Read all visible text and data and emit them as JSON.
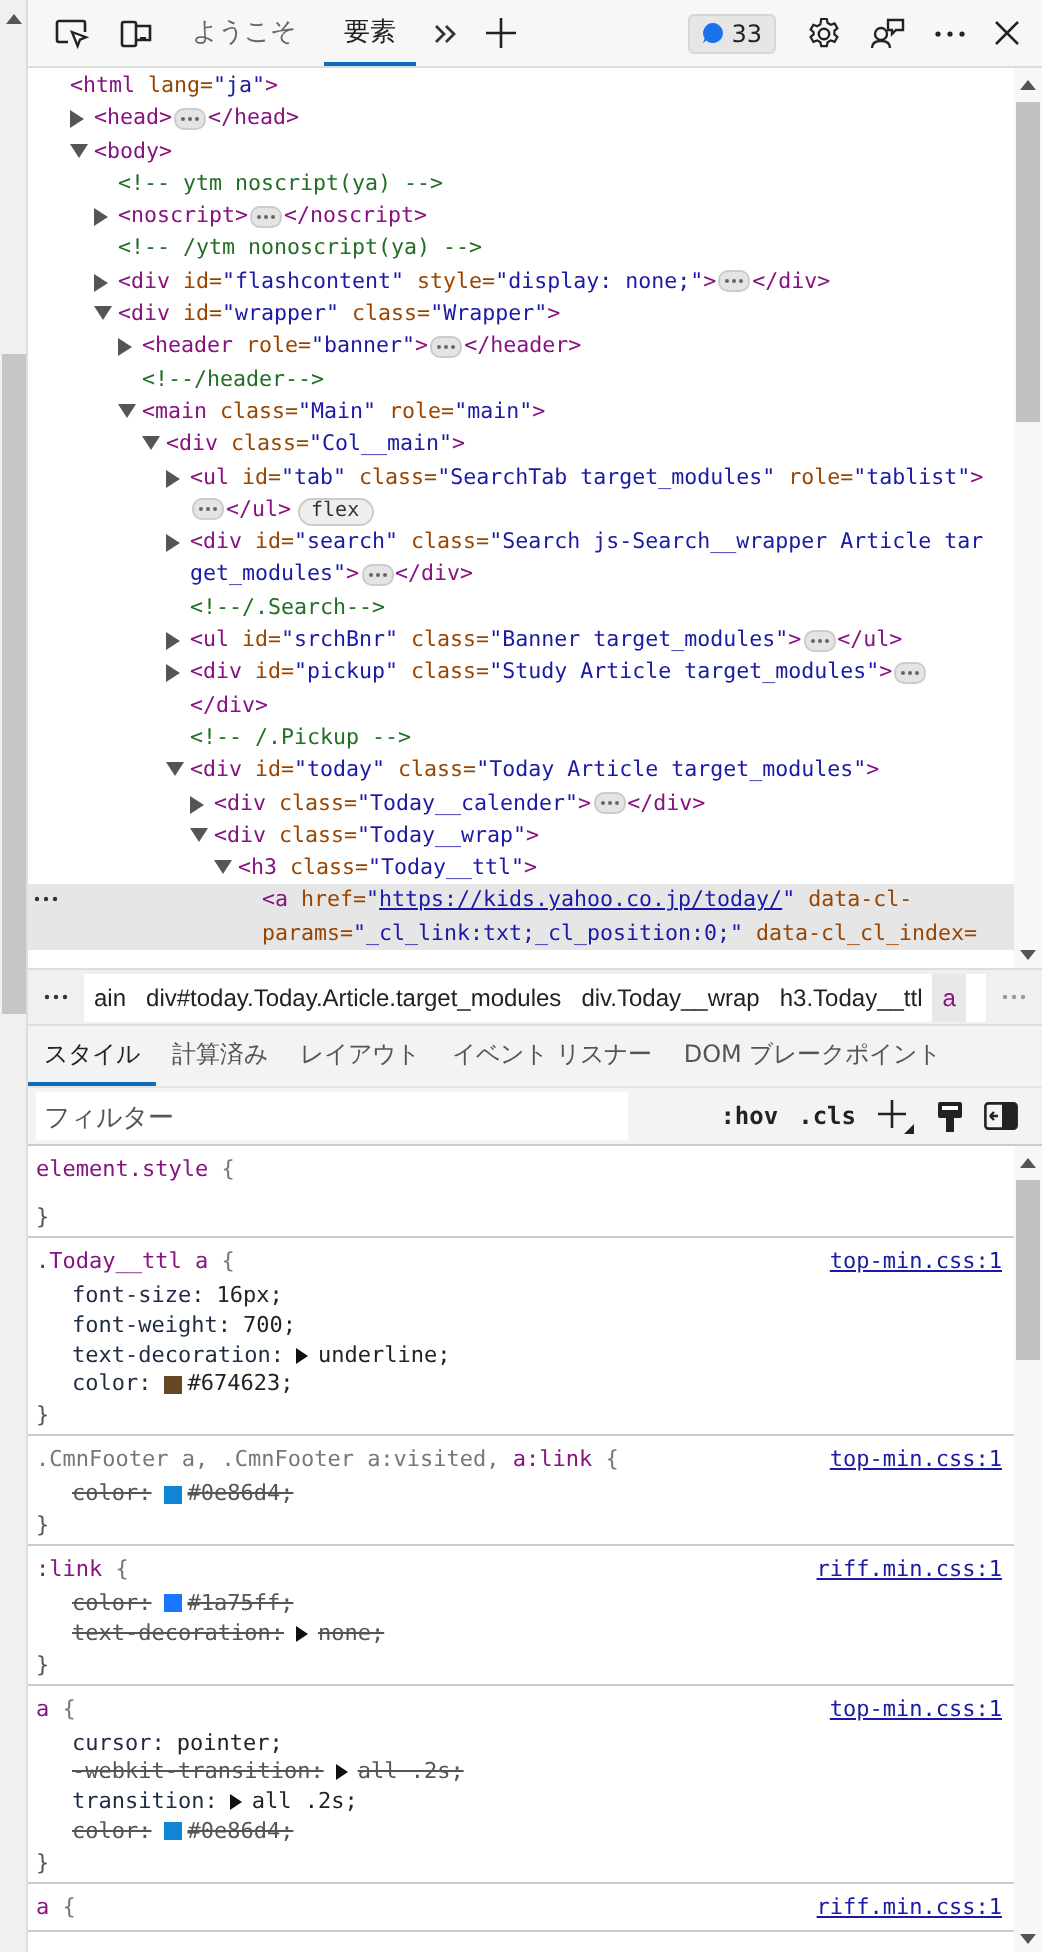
{
  "toolbar": {
    "tabs": [
      {
        "label": "ようこそ",
        "selected": false
      },
      {
        "label": "要素",
        "selected": true
      }
    ],
    "issues_count": "33"
  },
  "dom": [
    {
      "selected": false,
      "lines": [
        [
          {
            "kind": "code",
            "parts": [
              {
                "kind": "tag",
                "text": "<html"
              },
              {
                "kind": "attr",
                "text": " lang="
              },
              {
                "kind": "val",
                "text": "\"ja\""
              },
              {
                "kind": "tag",
                "text": ">"
              }
            ]
          }
        ]
      ],
      "children": [
        {
          "selected": false,
          "expanded": false,
          "lines": [
            [
              {
                "kind": "code",
                "parts": [
                  {
                    "kind": "tag",
                    "text": "<head>"
                  }
                ]
              },
              {
                "kind": "ellipsis"
              },
              {
                "kind": "code",
                "parts": [
                  {
                    "kind": "tag",
                    "text": "</head>"
                  }
                ]
              }
            ]
          ]
        },
        {
          "selected": false,
          "expanded": true,
          "lines": [
            [
              {
                "kind": "code",
                "parts": [
                  {
                    "kind": "tag",
                    "text": "<body>"
                  }
                ]
              }
            ]
          ],
          "children": [
            {
              "selected": false,
              "lines": [
                [
                  {
                    "kind": "code",
                    "parts": [
                      {
                        "kind": "cmt",
                        "text": "<!-- ytm noscript(ya) -->"
                      }
                    ]
                  }
                ]
              ]
            },
            {
              "selected": false,
              "expanded": false,
              "lines": [
                [
                  {
                    "kind": "code",
                    "parts": [
                      {
                        "kind": "tag",
                        "text": "<noscript>"
                      }
                    ]
                  },
                  {
                    "kind": "ellipsis"
                  },
                  {
                    "kind": "code",
                    "parts": [
                      {
                        "kind": "tag",
                        "text": "</noscript>"
                      }
                    ]
                  }
                ]
              ]
            },
            {
              "selected": false,
              "lines": [
                [
                  {
                    "kind": "code",
                    "parts": [
                      {
                        "kind": "cmt",
                        "text": "<!-- /ytm nonoscript(ya) -->"
                      }
                    ]
                  }
                ]
              ]
            },
            {
              "selected": false,
              "expanded": false,
              "lines": [
                [
                  {
                    "kind": "code",
                    "parts": [
                      {
                        "kind": "tag",
                        "text": "<div"
                      },
                      {
                        "kind": "attr",
                        "text": " id="
                      },
                      {
                        "kind": "val",
                        "text": "\"flashcontent\""
                      },
                      {
                        "kind": "attr",
                        "text": " style="
                      },
                      {
                        "kind": "val",
                        "text": "\"display: none;\""
                      },
                      {
                        "kind": "tag",
                        "text": ">"
                      }
                    ]
                  },
                  {
                    "kind": "ellipsis"
                  },
                  {
                    "kind": "code",
                    "parts": [
                      {
                        "kind": "tag",
                        "text": "</div>"
                      }
                    ]
                  }
                ]
              ]
            },
            {
              "selected": false,
              "expanded": true,
              "lines": [
                [
                  {
                    "kind": "code",
                    "parts": [
                      {
                        "kind": "tag",
                        "text": "<div"
                      },
                      {
                        "kind": "attr",
                        "text": " id="
                      },
                      {
                        "kind": "val",
                        "text": "\"wrapper\""
                      },
                      {
                        "kind": "attr",
                        "text": " class="
                      },
                      {
                        "kind": "val",
                        "text": "\"Wrapper\""
                      },
                      {
                        "kind": "tag",
                        "text": ">"
                      }
                    ]
                  }
                ]
              ],
              "children": [
                {
                  "selected": false,
                  "expanded": false,
                  "lines": [
                    [
                      {
                        "kind": "code",
                        "parts": [
                          {
                            "kind": "tag",
                            "text": "<header"
                          },
                          {
                            "kind": "attr",
                            "text": " role="
                          },
                          {
                            "kind": "val",
                            "text": "\"banner\""
                          },
                          {
                            "kind": "tag",
                            "text": ">"
                          }
                        ]
                      },
                      {
                        "kind": "ellipsis"
                      },
                      {
                        "kind": "code",
                        "parts": [
                          {
                            "kind": "tag",
                            "text": "</header>"
                          }
                        ]
                      }
                    ]
                  ]
                },
                {
                  "selected": false,
                  "lines": [
                    [
                      {
                        "kind": "code",
                        "parts": [
                          {
                            "kind": "cmt",
                            "text": "<!--/header-->"
                          }
                        ]
                      }
                    ]
                  ]
                },
                {
                  "selected": false,
                  "expanded": true,
                  "lines": [
                    [
                      {
                        "kind": "code",
                        "parts": [
                          {
                            "kind": "tag",
                            "text": "<main"
                          },
                          {
                            "kind": "attr",
                            "text": " class="
                          },
                          {
                            "kind": "val",
                            "text": "\"Main\""
                          },
                          {
                            "kind": "attr",
                            "text": " role="
                          },
                          {
                            "kind": "val",
                            "text": "\"main\""
                          },
                          {
                            "kind": "tag",
                            "text": ">"
                          }
                        ]
                      }
                    ]
                  ],
                  "children": [
                    {
                      "selected": false,
                      "expanded": true,
                      "lines": [
                        [
                          {
                            "kind": "code",
                            "parts": [
                              {
                                "kind": "tag",
                                "text": "<div"
                              },
                              {
                                "kind": "attr",
                                "text": " class="
                              },
                              {
                                "kind": "val",
                                "text": "\"Col__main\""
                              },
                              {
                                "kind": "tag",
                                "text": ">"
                              }
                            ]
                          }
                        ]
                      ],
                      "children": [
                        {
                          "selected": false,
                          "expanded": false,
                          "lines": [
                            [
                              {
                                "kind": "code",
                                "parts": [
                                  {
                                    "kind": "tag",
                                    "text": "<ul"
                                  },
                                  {
                                    "kind": "attr",
                                    "text": " id="
                                  },
                                  {
                                    "kind": "val",
                                    "text": "\"tab\""
                                  },
                                  {
                                    "kind": "attr",
                                    "text": " class="
                                  },
                                  {
                                    "kind": "val",
                                    "text": "\"SearchTab target_modules\""
                                  },
                                  {
                                    "kind": "attr",
                                    "text": " role="
                                  },
                                  {
                                    "kind": "val",
                                    "text": "\"tablist\""
                                  },
                                  {
                                    "kind": "tag",
                                    "text": ">"
                                  }
                                ]
                              }
                            ],
                            [
                              {
                                "kind": "ellipsis"
                              },
                              {
                                "kind": "code",
                                "parts": [
                                  {
                                    "kind": "tag",
                                    "text": "</ul>"
                                  }
                                ]
                              },
                              {
                                "kind": "badge",
                                "text": "flex"
                              }
                            ]
                          ]
                        },
                        {
                          "selected": false,
                          "expanded": false,
                          "lines": [
                            [
                              {
                                "kind": "code",
                                "parts": [
                                  {
                                    "kind": "tag",
                                    "text": "<div"
                                  },
                                  {
                                    "kind": "attr",
                                    "text": " id="
                                  },
                                  {
                                    "kind": "val",
                                    "text": "\"search\""
                                  },
                                  {
                                    "kind": "attr",
                                    "text": " class="
                                  },
                                  {
                                    "kind": "val",
                                    "text": "\"Search js-Search__wrapper Article tar"
                                  }
                                ]
                              }
                            ],
                            [
                              {
                                "kind": "code",
                                "parts": [
                                  {
                                    "kind": "val",
                                    "text": "get_modules\""
                                  },
                                  {
                                    "kind": "tag",
                                    "text": ">"
                                  }
                                ]
                              },
                              {
                                "kind": "ellipsis"
                              },
                              {
                                "kind": "code",
                                "parts": [
                                  {
                                    "kind": "tag",
                                    "text": "</div>"
                                  }
                                ]
                              }
                            ]
                          ]
                        },
                        {
                          "selected": false,
                          "lines": [
                            [
                              {
                                "kind": "code",
                                "parts": [
                                  {
                                    "kind": "cmt",
                                    "text": "<!--/.Search-->"
                                  }
                                ]
                              }
                            ]
                          ]
                        },
                        {
                          "selected": false,
                          "expanded": false,
                          "lines": [
                            [
                              {
                                "kind": "code",
                                "parts": [
                                  {
                                    "kind": "tag",
                                    "text": "<ul"
                                  },
                                  {
                                    "kind": "attr",
                                    "text": " id="
                                  },
                                  {
                                    "kind": "val",
                                    "text": "\"srchBnr\""
                                  },
                                  {
                                    "kind": "attr",
                                    "text": " class="
                                  },
                                  {
                                    "kind": "val",
                                    "text": "\"Banner target_modules\""
                                  },
                                  {
                                    "kind": "tag",
                                    "text": ">"
                                  }
                                ]
                              },
                              {
                                "kind": "ellipsis"
                              },
                              {
                                "kind": "code",
                                "parts": [
                                  {
                                    "kind": "tag",
                                    "text": "</ul>"
                                  }
                                ]
                              }
                            ]
                          ]
                        },
                        {
                          "selected": false,
                          "expanded": false,
                          "lines": [
                            [
                              {
                                "kind": "code",
                                "parts": [
                                  {
                                    "kind": "tag",
                                    "text": "<div"
                                  },
                                  {
                                    "kind": "attr",
                                    "text": " id="
                                  },
                                  {
                                    "kind": "val",
                                    "text": "\"pickup\""
                                  },
                                  {
                                    "kind": "attr",
                                    "text": " class="
                                  },
                                  {
                                    "kind": "val",
                                    "text": "\"Study Article target_modules\""
                                  },
                                  {
                                    "kind": "tag",
                                    "text": ">"
                                  }
                                ]
                              },
                              {
                                "kind": "ellipsis"
                              }
                            ],
                            [
                              {
                                "kind": "code",
                                "parts": [
                                  {
                                    "kind": "tag",
                                    "text": "</div>"
                                  }
                                ]
                              }
                            ]
                          ]
                        },
                        {
                          "selected": false,
                          "lines": [
                            [
                              {
                                "kind": "code",
                                "parts": [
                                  {
                                    "kind": "cmt",
                                    "text": "<!-- /.Pickup -->"
                                  }
                                ]
                              }
                            ]
                          ]
                        },
                        {
                          "selected": false,
                          "expanded": true,
                          "lines": [
                            [
                              {
                                "kind": "code",
                                "parts": [
                                  {
                                    "kind": "tag",
                                    "text": "<div"
                                  },
                                  {
                                    "kind": "attr",
                                    "text": " id="
                                  },
                                  {
                                    "kind": "val",
                                    "text": "\"today\""
                                  },
                                  {
                                    "kind": "attr",
                                    "text": " class="
                                  },
                                  {
                                    "kind": "val",
                                    "text": "\"Today Article target_modules\""
                                  },
                                  {
                                    "kind": "tag",
                                    "text": ">"
                                  }
                                ]
                              }
                            ]
                          ],
                          "children": [
                            {
                              "selected": false,
                              "expanded": false,
                              "lines": [
                                [
                                  {
                                    "kind": "code",
                                    "parts": [
                                      {
                                        "kind": "tag",
                                        "text": "<div"
                                      },
                                      {
                                        "kind": "attr",
                                        "text": " class="
                                      },
                                      {
                                        "kind": "val",
                                        "text": "\"Today__calender\""
                                      },
                                      {
                                        "kind": "tag",
                                        "text": ">"
                                      }
                                    ]
                                  },
                                  {
                                    "kind": "ellipsis"
                                  },
                                  {
                                    "kind": "code",
                                    "parts": [
                                      {
                                        "kind": "tag",
                                        "text": "</div>"
                                      }
                                    ]
                                  }
                                ]
                              ]
                            },
                            {
                              "selected": false,
                              "expanded": true,
                              "lines": [
                                [
                                  {
                                    "kind": "code",
                                    "parts": [
                                      {
                                        "kind": "tag",
                                        "text": "<div"
                                      },
                                      {
                                        "kind": "attr",
                                        "text": " class="
                                      },
                                      {
                                        "kind": "val",
                                        "text": "\"Today__wrap\""
                                      },
                                      {
                                        "kind": "tag",
                                        "text": ">"
                                      }
                                    ]
                                  }
                                ]
                              ],
                              "children": [
                                {
                                  "selected": false,
                                  "expanded": true,
                                  "lines": [
                                    [
                                      {
                                        "kind": "code",
                                        "parts": [
                                          {
                                            "kind": "tag",
                                            "text": "<h3"
                                          },
                                          {
                                            "kind": "attr",
                                            "text": " class="
                                          },
                                          {
                                            "kind": "val",
                                            "text": "\"Today__ttl\""
                                          },
                                          {
                                            "kind": "tag",
                                            "text": ">"
                                          }
                                        ]
                                      }
                                    ]
                                  ],
                                  "children": [
                                    {
                                      "selected": true,
                                      "lines": [
                                        [
                                          {
                                            "kind": "code",
                                            "parts": [
                                              {
                                                "kind": "tag",
                                                "text": "<a"
                                              },
                                              {
                                                "kind": "attr",
                                                "text": " href="
                                              },
                                              {
                                                "kind": "val",
                                                "text": "\""
                                              },
                                              {
                                                "kind": "url",
                                                "text": "https://kids.yahoo.co.jp/today/"
                                              },
                                              {
                                                "kind": "val",
                                                "text": "\""
                                              },
                                              {
                                                "kind": "attr",
                                                "text": " data-cl-"
                                              }
                                            ]
                                          }
                                        ],
                                        [
                                          {
                                            "kind": "code",
                                            "parts": [
                                              {
                                                "kind": "attr",
                                                "text": "params="
                                              },
                                              {
                                                "kind": "val",
                                                "text": "\"_cl_link:txt;_cl_position:0;\""
                                              },
                                              {
                                                "kind": "attr",
                                                "text": " data-cl_cl_index="
                                              }
                                            ]
                                          }
                                        ]
                                      ]
                                    }
                                  ]
                                }
                              ]
                            }
                          ]
                        }
                      ]
                    }
                  ]
                }
              ]
            }
          ]
        }
      ]
    }
  ],
  "breadcrumbs": [
    {
      "label": "ain",
      "selected": false
    },
    {
      "label": "div#today.Today.Article.target_modules",
      "selected": false
    },
    {
      "label": "div.Today__wrap",
      "selected": false
    },
    {
      "label": "h3.Today__ttl",
      "selected": false
    },
    {
      "label": "a",
      "selected": true
    }
  ],
  "style_tabs": [
    {
      "label": "スタイル",
      "selected": true
    },
    {
      "label": "計算済み",
      "selected": false
    },
    {
      "label": "レイアウト",
      "selected": false
    },
    {
      "label": "イベント リスナー",
      "selected": false
    },
    {
      "label": "DOM ブレークポイント",
      "selected": false
    }
  ],
  "filter": {
    "placeholder": "フィルター",
    "hov": ":hov",
    "cls": ".cls"
  },
  "rules": [
    {
      "selector": [
        {
          "text": "element.style",
          "matched": true
        },
        {
          "text": " {",
          "matched": false
        }
      ],
      "close": "}"
    },
    {
      "selector": [
        {
          "text": ".Today__ttl a",
          "matched": true
        },
        {
          "text": " {",
          "matched": false
        }
      ],
      "source": "top-min.css:1",
      "decls": [
        {
          "name": "font-size:",
          "value": "16px;",
          "struck": false
        },
        {
          "name": "font-weight:",
          "value": "700;",
          "struck": false
        },
        {
          "name": "text-decoration:",
          "value": "underline;",
          "struck": false,
          "expandable": true
        },
        {
          "name": "color:",
          "value": "#674623;",
          "struck": false,
          "color": "#674623"
        }
      ],
      "close": "}"
    },
    {
      "selector": [
        {
          "text": ".CmnFooter a, .CmnFooter a:visited,",
          "matched": false
        },
        {
          "text": " a:link",
          "matched": true
        },
        {
          "text": " {",
          "matched": false
        }
      ],
      "source": "top-min.css:1",
      "decls": [
        {
          "name": "color:",
          "value": "#0e86d4;",
          "struck": true,
          "color": "#0e86d4"
        }
      ],
      "close": "}"
    },
    {
      "selector": [
        {
          "text": ":link",
          "matched": true
        },
        {
          "text": " {",
          "matched": false
        }
      ],
      "source": "riff.min.css:1",
      "decls": [
        {
          "name": "color:",
          "value": "#1a75ff;",
          "struck": true,
          "color": "#1a75ff"
        },
        {
          "name": "text-decoration:",
          "value": "none;",
          "struck": true,
          "expandable": true
        }
      ],
      "close": "}"
    },
    {
      "selector": [
        {
          "text": "a",
          "matched": true
        },
        {
          "text": " {",
          "matched": false
        }
      ],
      "source": "top-min.css:1",
      "decls": [
        {
          "name": "cursor:",
          "value": "pointer;",
          "struck": false
        },
        {
          "name": "-webkit-transition:",
          "value": "all .2s;",
          "struck": true,
          "expandable": true
        },
        {
          "name": "transition:",
          "value": "all .2s;",
          "struck": false,
          "expandable": true
        },
        {
          "name": "color:",
          "value": "#0e86d4;",
          "struck": true,
          "color": "#0e86d4"
        }
      ],
      "close": "}"
    },
    {
      "selector": [
        {
          "text": "a",
          "matched": true
        },
        {
          "text": " {",
          "matched": false
        }
      ],
      "source": "riff.min.css:1"
    }
  ]
}
